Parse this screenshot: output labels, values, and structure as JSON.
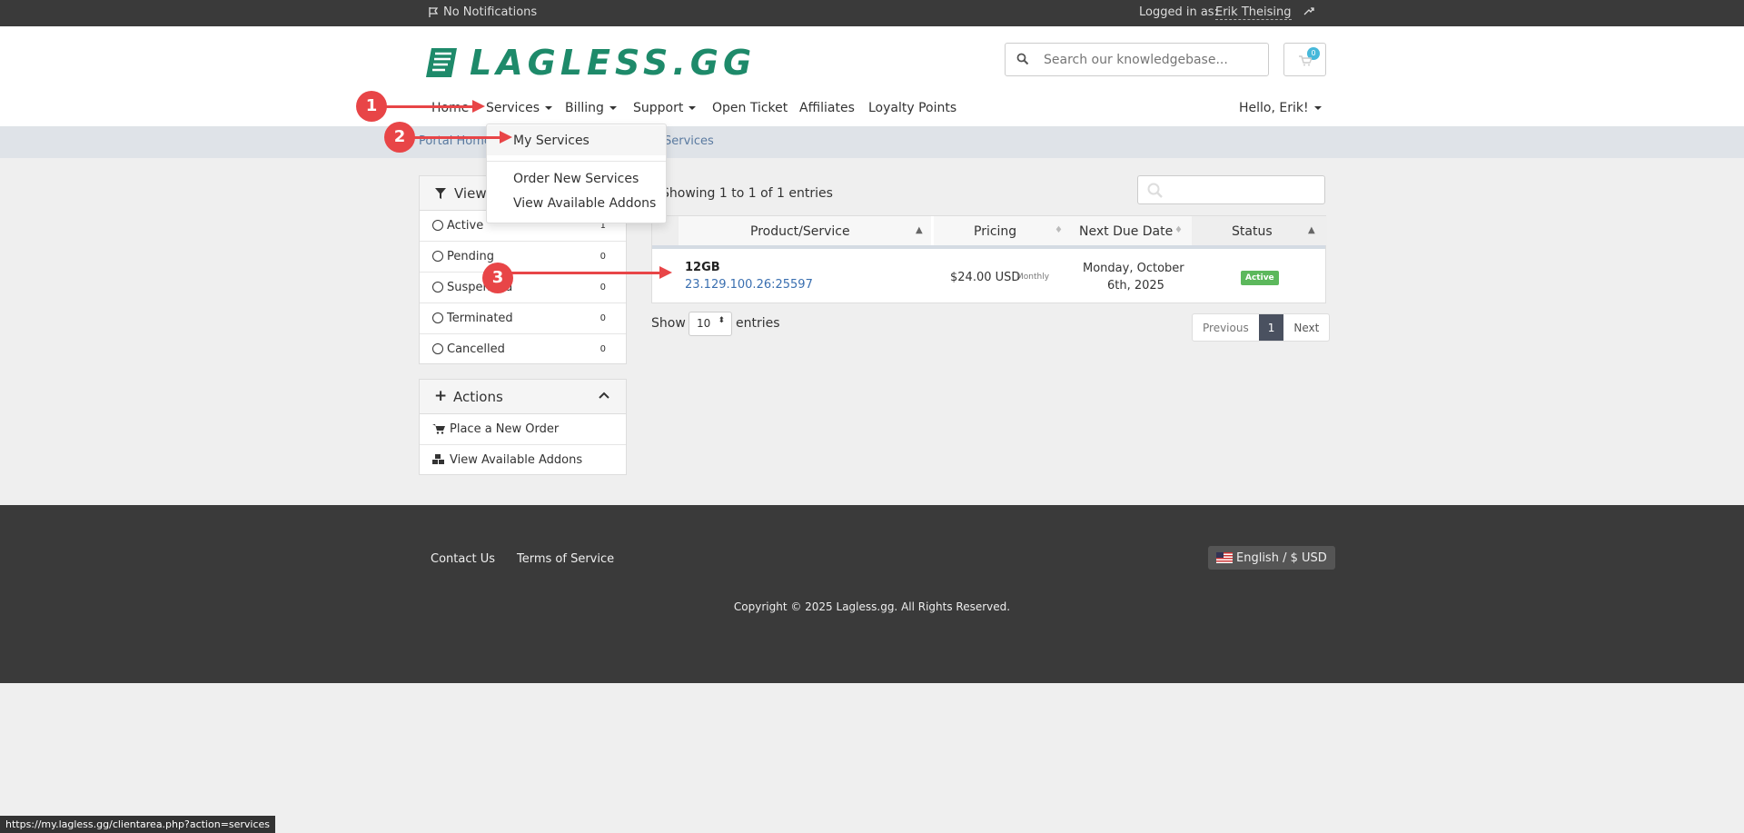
{
  "topbar": {
    "notifications": "No Notifications",
    "logged_in_label": "Logged in as:",
    "user_name": "Erik Theising"
  },
  "header": {
    "logo_text": "LAGLESS.GG",
    "search_placeholder": "Search our knowledgebase...",
    "cart_count": "0"
  },
  "nav": {
    "home": "Home",
    "services": "Services",
    "billing": "Billing",
    "support": "Support",
    "open_ticket": "Open Ticket",
    "affiliates": "Affiliates",
    "loyalty_points": "Loyalty Points",
    "hello": "Hello, Erik!"
  },
  "breadcrumb": {
    "portal_home": "Portal Home",
    "current": "Services"
  },
  "services_dropdown": {
    "my_services": "My Services",
    "order_new": "Order New Services",
    "view_addons": "View Available Addons"
  },
  "sidebar": {
    "view_title": "View",
    "filters": [
      {
        "label": "Active",
        "count": "1"
      },
      {
        "label": "Pending",
        "count": "0"
      },
      {
        "label": "Suspended",
        "count": "0"
      },
      {
        "label": "Terminated",
        "count": "0"
      },
      {
        "label": "Cancelled",
        "count": "0"
      }
    ],
    "actions_title": "Actions",
    "actions": [
      {
        "label": "Place a New Order"
      },
      {
        "label": "View Available Addons"
      }
    ]
  },
  "table": {
    "showing": "Showing 1 to 1 of 1 entries",
    "columns": [
      "Product/Service",
      "Pricing",
      "Next Due Date",
      "Status"
    ],
    "rows": [
      {
        "product": "12GB",
        "address": "23.129.100.26:25597",
        "price": "$24.00 USD",
        "cycle": "Monthly",
        "due_line1": "Monday, October",
        "due_line2": "6th, 2025",
        "status": "Active"
      }
    ],
    "show_label": "Show",
    "entries_label": "entries",
    "page_length": "10",
    "pager": {
      "previous": "Previous",
      "current": "1",
      "next": "Next"
    }
  },
  "footer": {
    "contact": "Contact Us",
    "terms": "Terms of Service",
    "language": "English / $ USD",
    "copyright": "Copyright © 2025 Lagless.gg. All Rights Reserved."
  },
  "status_url": "https://my.lagless.gg/clientarea.php?action=services",
  "annotations": [
    "1",
    "2",
    "3"
  ],
  "colors": {
    "brand": "#1e8a6a",
    "annotation": "#e84547",
    "active_badge": "#5cb85c"
  }
}
